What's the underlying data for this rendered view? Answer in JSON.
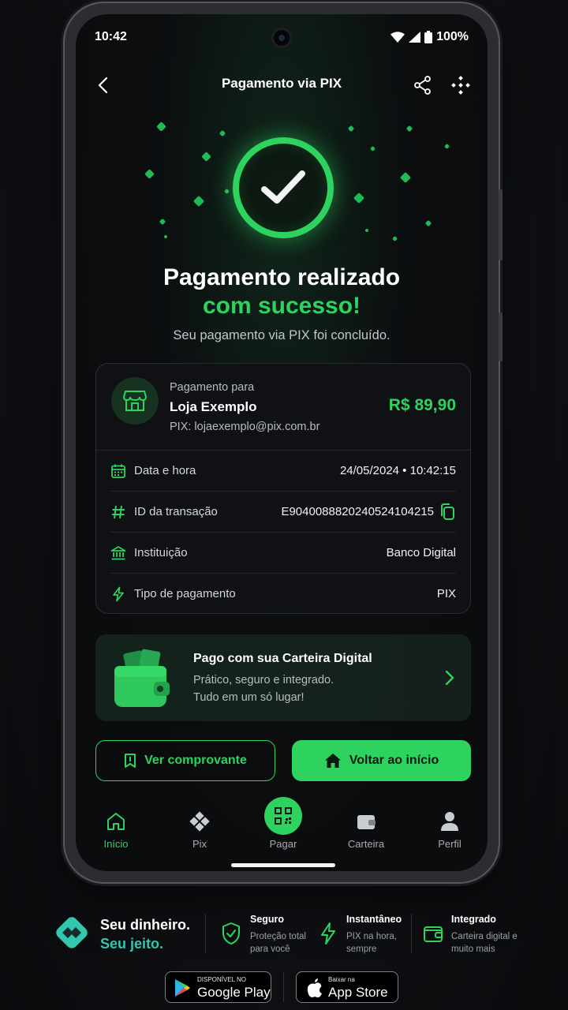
{
  "status_bar": {
    "time": "10:42",
    "battery": "100%"
  },
  "header": {
    "title": "Pagamento via PIX"
  },
  "success": {
    "title_line1": "Pagamento realizado",
    "title_line2": "com sucesso!",
    "subtitle": "Seu pagamento via PIX foi concluído."
  },
  "payment": {
    "pay_to_label": "Pagamento para",
    "merchant": "Loja Exemplo",
    "pix_key": "PIX: lojaexemplo@pix.com.br",
    "amount": "R$ 89,90"
  },
  "details": [
    {
      "label": "Data e hora",
      "value": "24/05/2024 • 10:42:15"
    },
    {
      "label": "ID da transação",
      "value": "E9040088820240524104215"
    },
    {
      "label": "Instituição",
      "value": "Banco Digital"
    },
    {
      "label": "Tipo de pagamento",
      "value": "PIX"
    }
  ],
  "wallet_banner": {
    "title": "Pago com sua Carteira Digital",
    "line1": "Prático, seguro e integrado.",
    "line2": "Tudo em um só lugar!"
  },
  "actions": {
    "receipt": "Ver comprovante",
    "home": "Voltar ao início"
  },
  "nav": [
    {
      "label": "Início"
    },
    {
      "label": "Pix"
    },
    {
      "label": "Pagar"
    },
    {
      "label": "Carteira"
    },
    {
      "label": "Perfil"
    }
  ],
  "promo": {
    "brand_line1": "Seu dinheiro.",
    "brand_line2": "Seu jeito.",
    "features": [
      {
        "title": "Seguro",
        "desc": "Proteção total para você"
      },
      {
        "title": "Instantâneo",
        "desc": "PIX na hora, sempre"
      },
      {
        "title": "Integrado",
        "desc": "Carteira digital e muito mais"
      }
    ],
    "google_small": "DISPONÍVEL NO",
    "google_big": "Google Play",
    "apple_small": "Baixar na",
    "apple_big": "App Store"
  },
  "colors": {
    "accent": "#2ed35f",
    "brand_teal": "#32c8b0",
    "background": "#0b0c0e"
  }
}
